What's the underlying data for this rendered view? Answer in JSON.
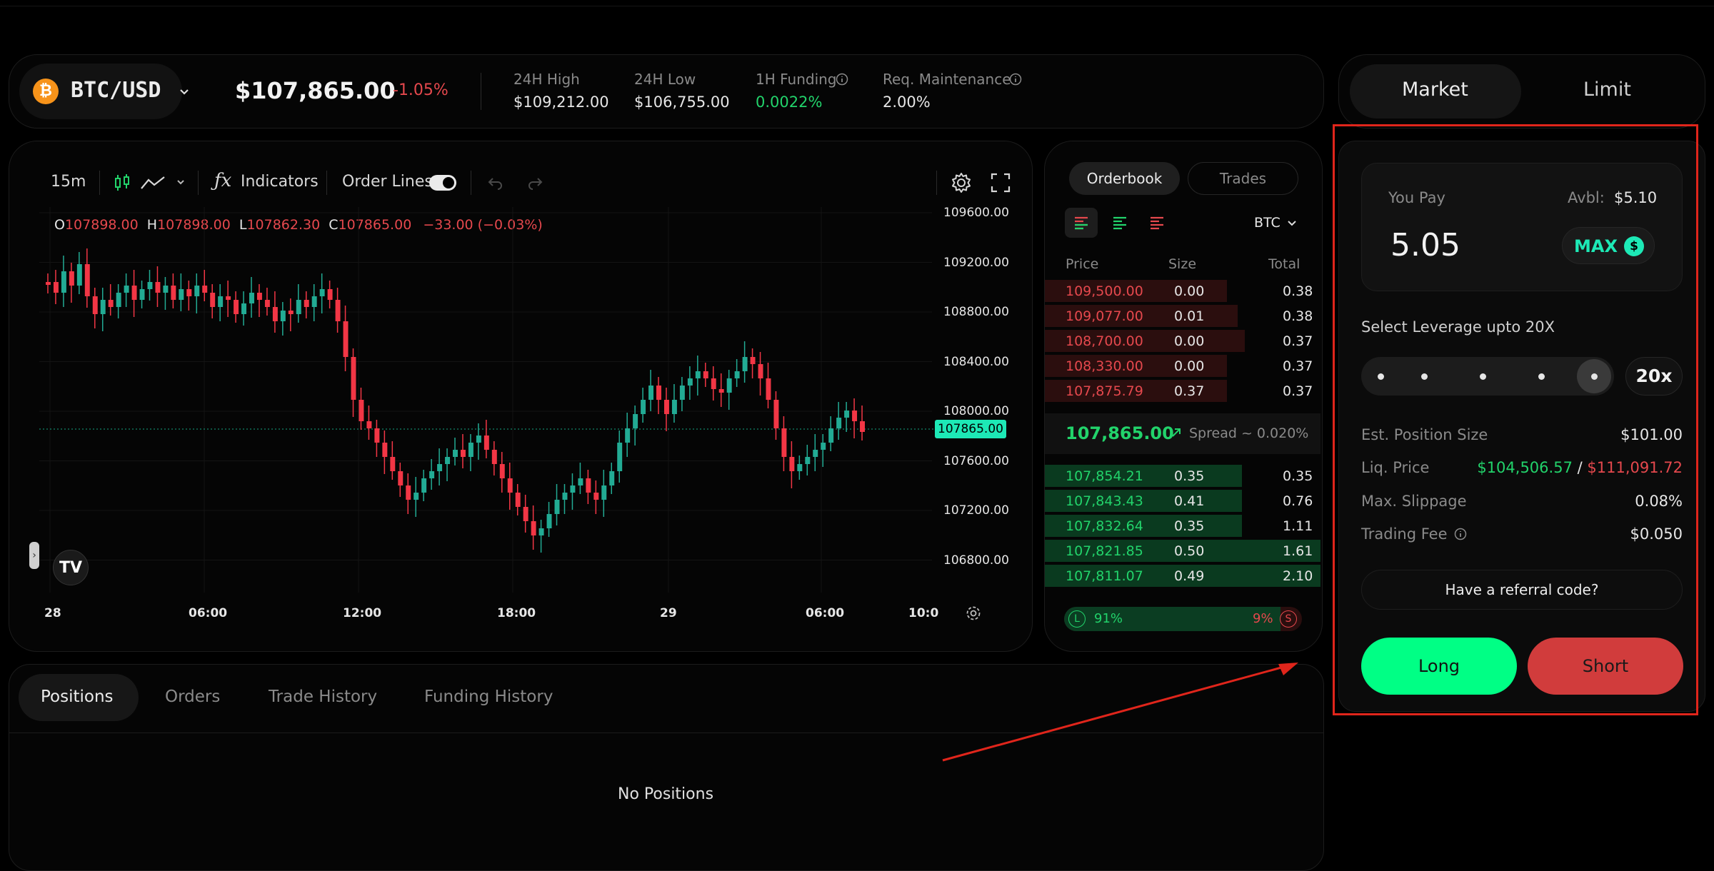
{
  "header": {
    "pair": "BTC/USD",
    "price": "$107,865.00",
    "change": "-1.05%",
    "stats": [
      {
        "label": "24H High",
        "value": "$109,212.00"
      },
      {
        "label": "24H Low",
        "value": "$106,755.00"
      },
      {
        "label": "1H Funding",
        "value": "0.0022%"
      },
      {
        "label": "Req. Maintenance",
        "value": "2.00%"
      }
    ]
  },
  "order_type_tabs": {
    "market": "Market",
    "limit": "Limit"
  },
  "chart_toolbar": {
    "interval": "15m",
    "indicators": "Indicators",
    "order_lines": "Order Lines"
  },
  "ohlc": {
    "o_label": "O",
    "o": "107898.00",
    "h_label": "H",
    "h": "107898.00",
    "l_label": "L",
    "l": "107862.30",
    "c_label": "C",
    "c": "107865.00",
    "change": "−33.00 (−0.03%)"
  },
  "price_axis": [
    "109600.00",
    "109200.00",
    "108800.00",
    "108400.00",
    "108000.00",
    "107600.00",
    "107200.00",
    "106800.00"
  ],
  "current_price_tag": "107865.00",
  "time_axis": [
    "28",
    "06:00",
    "12:00",
    "18:00",
    "29",
    "06:00",
    "10:0"
  ],
  "colors": {
    "up": "#22ab94",
    "down": "#f23645",
    "long": "#00ff85",
    "short": "#d13c3c",
    "accent_teal": "#1de9b6"
  },
  "orderbook": {
    "tabs": {
      "orderbook": "Orderbook",
      "trades": "Trades"
    },
    "asset": "BTC",
    "headers": {
      "price": "Price",
      "size": "Size",
      "total": "Total"
    },
    "asks": [
      {
        "price": "109,500.00",
        "size": "0.00",
        "total": "0.38"
      },
      {
        "price": "109,077.00",
        "size": "0.01",
        "total": "0.38"
      },
      {
        "price": "108,700.00",
        "size": "0.00",
        "total": "0.37"
      },
      {
        "price": "108,330.00",
        "size": "0.00",
        "total": "0.37"
      },
      {
        "price": "107,875.79",
        "size": "0.37",
        "total": "0.37"
      }
    ],
    "mid_price": "107,865.00",
    "spread": "Spread ~ 0.020%",
    "bids": [
      {
        "price": "107,854.21",
        "size": "0.35",
        "total": "0.35"
      },
      {
        "price": "107,843.43",
        "size": "0.41",
        "total": "0.76"
      },
      {
        "price": "107,832.64",
        "size": "0.35",
        "total": "1.11"
      },
      {
        "price": "107,821.85",
        "size": "0.50",
        "total": "1.61"
      },
      {
        "price": "107,811.07",
        "size": "0.49",
        "total": "2.10"
      }
    ],
    "long_label": "L",
    "long_pct": "91%",
    "short_pct": "9%",
    "short_label": "S",
    "long_ratio": 0.91
  },
  "positions": {
    "tabs": [
      "Positions",
      "Orders",
      "Trade History",
      "Funding History"
    ],
    "empty": "No Positions"
  },
  "trade_panel": {
    "you_pay": "You Pay",
    "avbl_label": "Avbl:",
    "avbl_value": "$5.10",
    "amount": "5.05",
    "max": "MAX",
    "leverage_label": "Select Leverage upto 20X",
    "leverage_value": "20x",
    "rows": [
      {
        "label": "Est. Position Size",
        "value": "$101.00"
      },
      {
        "label": "Liq. Price",
        "value_long": "$104,506.57",
        "sep": "/",
        "value_short": "$111,091.72"
      },
      {
        "label": "Max. Slippage",
        "value": "0.08%"
      },
      {
        "label": "Trading Fee",
        "value": "$0.050"
      }
    ],
    "referral": "Have a referral code?",
    "long": "Long",
    "short": "Short"
  }
}
